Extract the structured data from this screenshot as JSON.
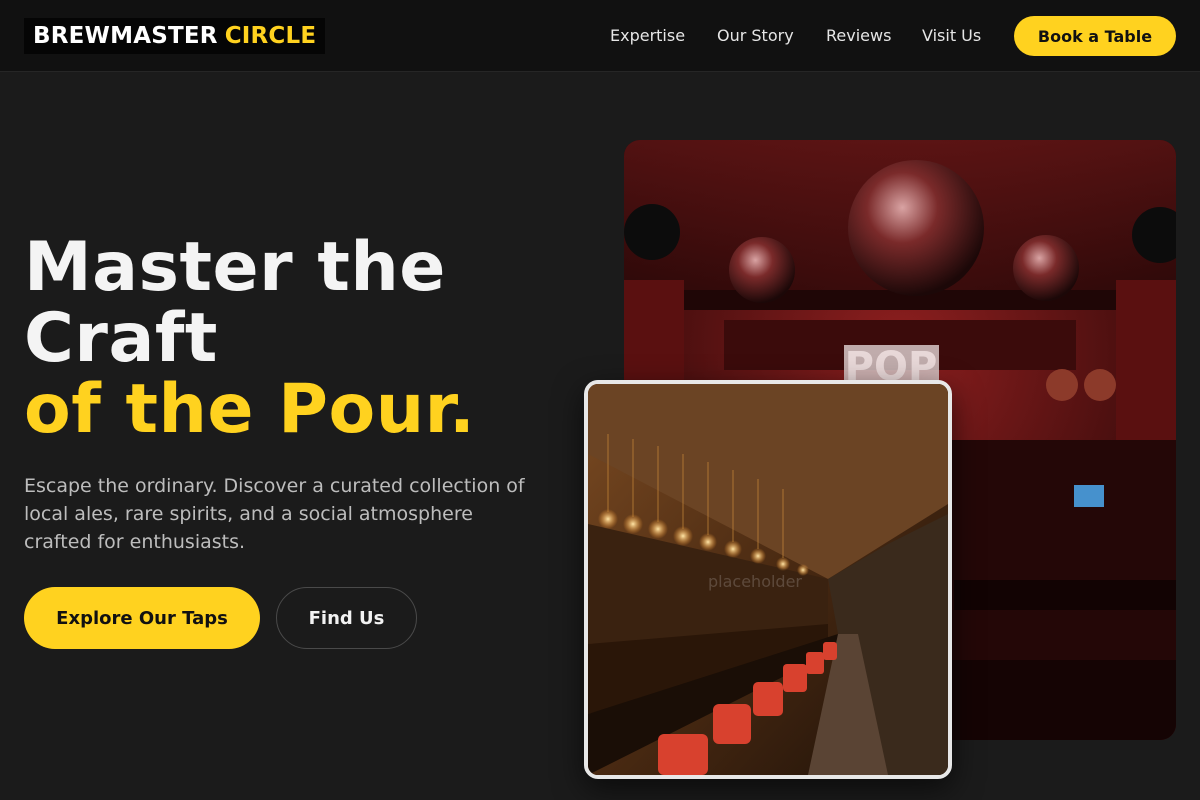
{
  "brand": {
    "name_part1": "BREWMASTER",
    "name_part2": "CIRCLE"
  },
  "nav": {
    "links": [
      "Expertise",
      "Our Story",
      "Reviews",
      "Visit Us"
    ],
    "cta_label": "Book a Table"
  },
  "hero": {
    "title_line1": "Master the",
    "title_line2": "Craft",
    "title_line3": "of the Pour.",
    "subtitle": "Escape the ordinary. Discover a curated collection of local ales, rare spirits, and a social atmosphere crafted for enthusiasts.",
    "primary_cta": "Explore Our Taps",
    "secondary_cta": "Find Us"
  },
  "images": {
    "main_sign_text": "POP",
    "secondary_placeholder": "placeholder"
  },
  "colors": {
    "accent": "#ffd21f",
    "background": "#1b1b1b",
    "header_bg": "#111111"
  }
}
